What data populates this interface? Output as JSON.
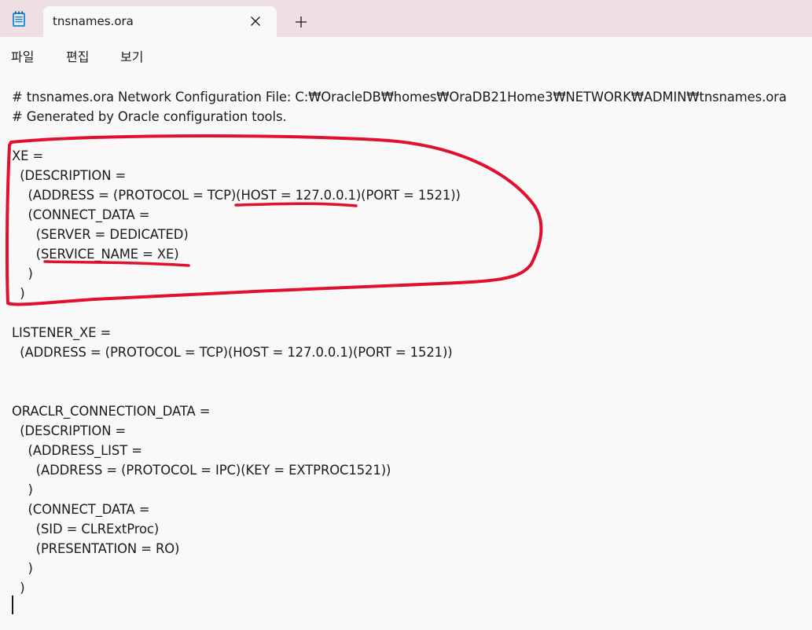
{
  "tab": {
    "title": "tnsnames.ora",
    "close_symbol": "✕",
    "new_tab_symbol": "+"
  },
  "menu": {
    "file": "파일",
    "edit": "편집",
    "view": "보기"
  },
  "editor": {
    "lines": [
      "# tnsnames.ora Network Configuration File: C:₩OracleDB₩homes₩OraDB21Home3₩NETWORK₩ADMIN₩tnsnames.ora",
      "# Generated by Oracle configuration tools.",
      "",
      "XE =",
      "  (DESCRIPTION =",
      "    (ADDRESS = (PROTOCOL = TCP)(HOST = 127.0.0.1)(PORT = 1521))",
      "    (CONNECT_DATA =",
      "      (SERVER = DEDICATED)",
      "      (SERVICE_NAME = XE)",
      "    )",
      "  )",
      "",
      "LISTENER_XE =",
      "  (ADDRESS = (PROTOCOL = TCP)(HOST = 127.0.0.1)(PORT = 1521))",
      "",
      "",
      "ORACLR_CONNECTION_DATA =",
      "  (DESCRIPTION =",
      "    (ADDRESS_LIST =",
      "      (ADDRESS = (PROTOCOL = IPC)(KEY = EXTPROC1521))",
      "    )",
      "    (CONNECT_DATA =",
      "      (SID = CLRExtProc)",
      "      (PRESENTATION = RO)",
      "    )",
      "  )"
    ]
  },
  "colors": {
    "tabbar_bg": "#eedfe3",
    "editor_bg": "#f9f9f9",
    "text": "#1b1b1b",
    "annotation_red": "#e0102e"
  }
}
